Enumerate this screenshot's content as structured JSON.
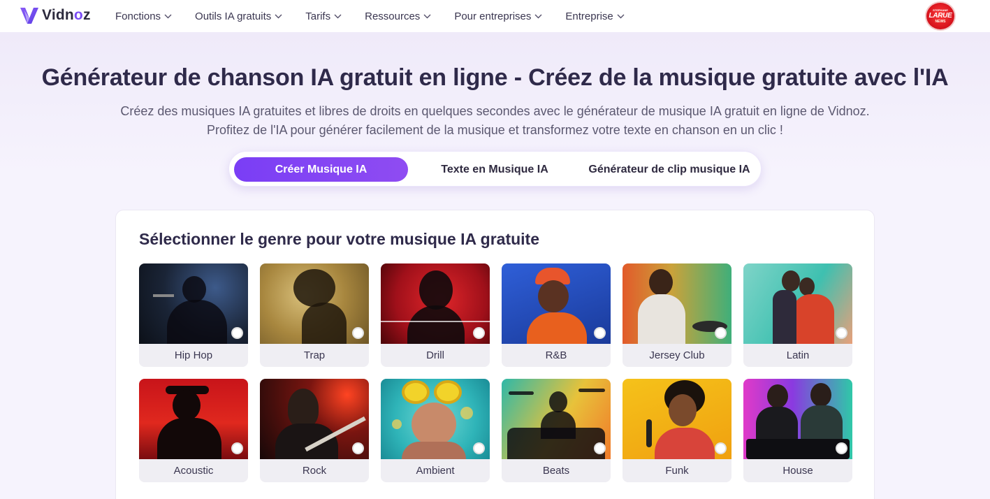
{
  "nav": {
    "brand": "Vidnoz",
    "items": [
      "Fonctions",
      "Outils IA gratuits",
      "Tarifs",
      "Ressources",
      "Pour entreprises",
      "Entreprise"
    ],
    "avatar": {
      "line1": "STEPHANE",
      "line2": "LARUE",
      "line3": "NEWS"
    }
  },
  "hero": {
    "title": "Générateur de chanson IA gratuit en ligne - Créez de la musique gratuite avec l'IA",
    "subtitle": "Créez des musiques IA gratuites et libres de droits en quelques secondes avec le générateur de musique IA gratuit en ligne de Vidnoz. Profitez de l'IA pour générer facilement de la musique et transformez votre texte en chanson en un clic !"
  },
  "tabs": [
    {
      "label": "Créer Musique IA",
      "active": true
    },
    {
      "label": "Texte en Musique IA",
      "active": false
    },
    {
      "label": "Générateur de clip musique IA",
      "active": false
    }
  ],
  "genres_section": {
    "title": "Sélectionner le genre pour votre musique IA gratuite",
    "genres": [
      {
        "label": "Hip Hop"
      },
      {
        "label": "Trap"
      },
      {
        "label": "Drill"
      },
      {
        "label": "R&B"
      },
      {
        "label": "Jersey Club"
      },
      {
        "label": "Latin"
      },
      {
        "label": "Acoustic"
      },
      {
        "label": "Rock"
      },
      {
        "label": "Ambient"
      },
      {
        "label": "Beats"
      },
      {
        "label": "Funk"
      },
      {
        "label": "House"
      }
    ]
  },
  "colors": {
    "accent": "#7a3ef5",
    "title": "#2f2a4a",
    "background": "#f6f3fd"
  }
}
